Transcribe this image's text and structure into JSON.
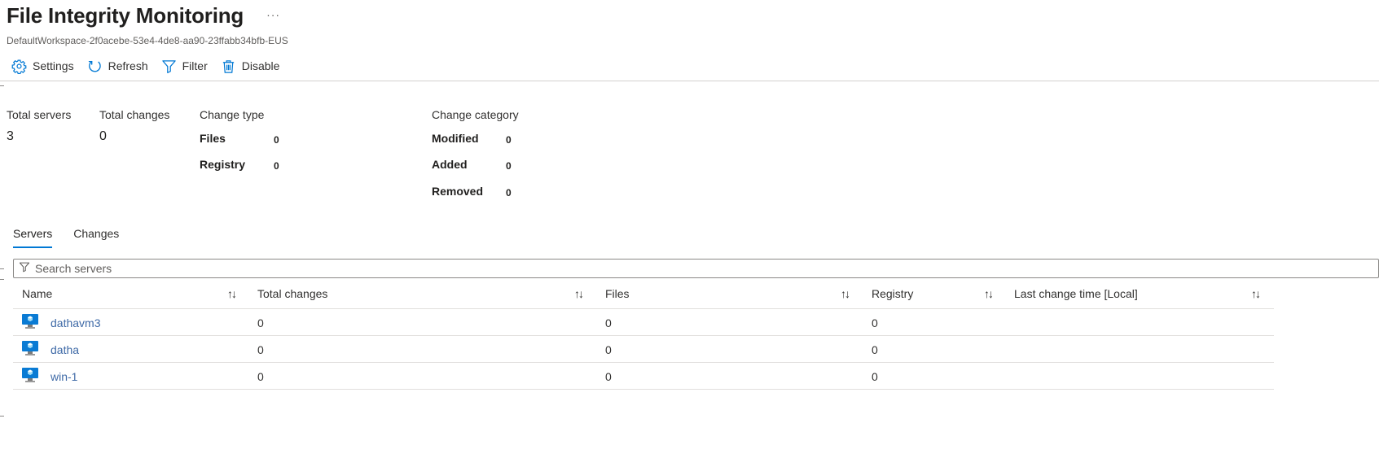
{
  "header": {
    "title": "File Integrity Monitoring",
    "more": "···",
    "subtitle": "DefaultWorkspace-2f0acebe-53e4-4de8-aa90-23ffabb34bfb-EUS"
  },
  "toolbar": {
    "settings_label": "Settings",
    "refresh_label": "Refresh",
    "filter_label": "Filter",
    "disable_label": "Disable"
  },
  "summary": {
    "total_servers_label": "Total servers",
    "total_servers_value": "3",
    "total_changes_label": "Total changes",
    "total_changes_value": "0",
    "change_type_label": "Change type",
    "change_type": [
      {
        "label": "Files",
        "value": "0"
      },
      {
        "label": "Registry",
        "value": "0"
      }
    ],
    "change_category_label": "Change category",
    "change_category": [
      {
        "label": "Modified",
        "value": "0"
      },
      {
        "label": "Added",
        "value": "0"
      },
      {
        "label": "Removed",
        "value": "0"
      }
    ]
  },
  "tabs": [
    {
      "label": "Servers",
      "active": true
    },
    {
      "label": "Changes",
      "active": false
    }
  ],
  "search": {
    "placeholder": "Search servers"
  },
  "table": {
    "sort_glyph": "↑↓",
    "columns": [
      "Name",
      "Total changes",
      "Files",
      "Registry",
      "Last change time [Local]"
    ],
    "rows": [
      {
        "name": "dathavm3",
        "total_changes": "0",
        "files": "0",
        "registry": "0",
        "last_change": ""
      },
      {
        "name": "datha",
        "total_changes": "0",
        "files": "0",
        "registry": "0",
        "last_change": ""
      },
      {
        "name": "win-1",
        "total_changes": "0",
        "files": "0",
        "registry": "0",
        "last_change": ""
      }
    ]
  },
  "colors": {
    "accent": "#0078d4",
    "link": "#3f6aa7",
    "vm_icon": "#0a7bd4"
  },
  "icons": [
    "gear-icon",
    "refresh-icon",
    "filter-icon",
    "trash-icon",
    "virtual-machine-icon"
  ]
}
